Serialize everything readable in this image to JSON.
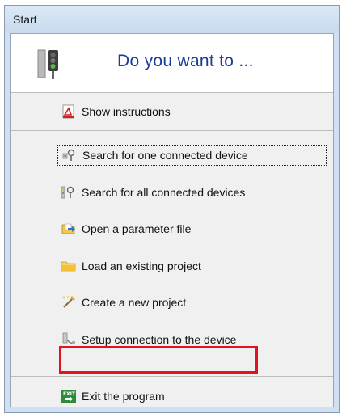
{
  "window": {
    "title": "Start"
  },
  "header": {
    "heading": "Do you want to ..."
  },
  "menu": {
    "show_instructions": "Show instructions",
    "search_one": "Search for one connected device",
    "search_all": "Search for all connected devices",
    "open_param": "Open a parameter file",
    "load_project": "Load an existing project",
    "create_project": "Create a new project",
    "setup_connection": "Setup connection to the device",
    "exit_program": "Exit the program"
  },
  "icons": {
    "header": "traffic-light-icon",
    "show_instructions": "pdf-document-icon",
    "search_one": "search-device-icon",
    "search_all": "search-devices-icon",
    "open_param": "open-file-icon",
    "load_project": "folder-icon",
    "create_project": "new-project-icon",
    "setup_connection": "connection-icon",
    "exit_program": "exit-icon"
  },
  "colors": {
    "heading": "#1a3d9a",
    "highlight": "#e0141c"
  }
}
